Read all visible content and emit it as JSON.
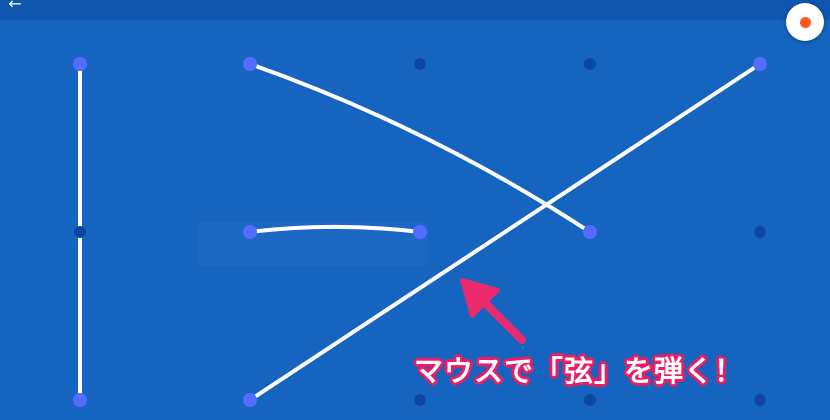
{
  "toolbar": {
    "back_icon": "←",
    "record_color": "#FF5722"
  },
  "annotation": {
    "caption": "マウスで「弦」を弾く！",
    "arrow_color": "#EC2A6E"
  },
  "colors": {
    "background": "#1565C0",
    "topbar": "#1055AE",
    "peg_inactive": "#0D47A1",
    "peg_active": "#536DFE",
    "string": "#FFFFFF"
  },
  "board": {
    "columns": 5,
    "rows": 3,
    "active_pegs": [
      [
        0,
        0
      ],
      [
        0,
        2
      ],
      [
        1,
        0
      ],
      [
        1,
        1
      ],
      [
        1,
        2
      ],
      [
        2,
        1
      ],
      [
        3,
        1
      ],
      [
        4,
        0
      ]
    ],
    "strings": [
      {
        "from": [
          0,
          0
        ],
        "to": [
          0,
          2
        ],
        "curved": false
      },
      {
        "from": [
          1,
          0
        ],
        "to": [
          3,
          1
        ],
        "curved": true
      },
      {
        "from": [
          4,
          0
        ],
        "to": [
          1,
          2
        ],
        "curved": false
      },
      {
        "from": [
          1,
          1
        ],
        "to": [
          2,
          1
        ],
        "curved": true
      }
    ]
  }
}
